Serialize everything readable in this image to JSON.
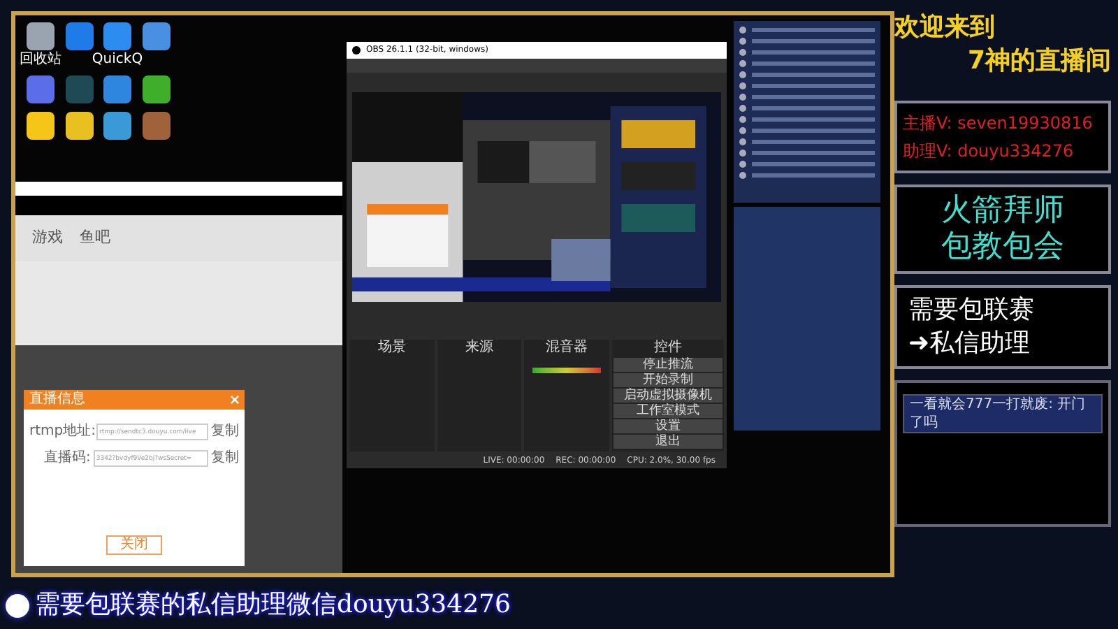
{
  "desktop": {
    "icons": [
      {
        "color": "#9aa4b0",
        "label": "回收站"
      },
      {
        "color": "#1e7be8"
      },
      {
        "color": "#2d8cf0",
        "label": "QuickQ"
      },
      {
        "color": "#4a90e2"
      },
      {
        "color": "#5b6ee8"
      },
      {
        "color": "#1f4a55"
      },
      {
        "color": "#2f86de"
      },
      {
        "color": "#3fae2a"
      },
      {
        "color": "#f5c518"
      },
      {
        "color": "#e8c020"
      },
      {
        "color": "#3a9ad8"
      },
      {
        "color": "#a0623a"
      }
    ]
  },
  "browser": {
    "nav": [
      "游戏",
      "鱼吧"
    ],
    "dialog": {
      "title": "直播信息",
      "fields": [
        {
          "label": "rtmp地址:",
          "value": "rtmp://sendtc3.douyu.com/live",
          "action": "复制"
        },
        {
          "label": "直播码:",
          "value": "3342?bvdyf9Ve2bj?wsSecret=",
          "action": "复制"
        }
      ],
      "button": "关闭"
    }
  },
  "obs": {
    "title": "OBS 26.1.1 (32-bit, windows)",
    "docks": [
      "场景",
      "来源",
      "混音器",
      "控件"
    ],
    "controls": [
      "停止推流",
      "开始录制",
      "启动虚拟摄像机",
      "工作室模式",
      "设置",
      "退出"
    ],
    "status": [
      "LIVE: 00:00:00",
      "REC: 00:00:00",
      "CPU: 2.0%, 30.00 fps"
    ]
  },
  "overlay": {
    "welcome": [
      "欢迎来到",
      "7神的直播间"
    ],
    "contacts": [
      "主播V: seven19930816",
      "助理V: douyu334276"
    ],
    "promo": [
      "火箭拜师",
      "包教包会"
    ],
    "league": [
      "需要包联赛",
      "➜私信助理"
    ],
    "viewer_card": "一看就会777一打就废: 开门了吗"
  },
  "banner": "需要包联赛的私信助理微信douyu334276"
}
